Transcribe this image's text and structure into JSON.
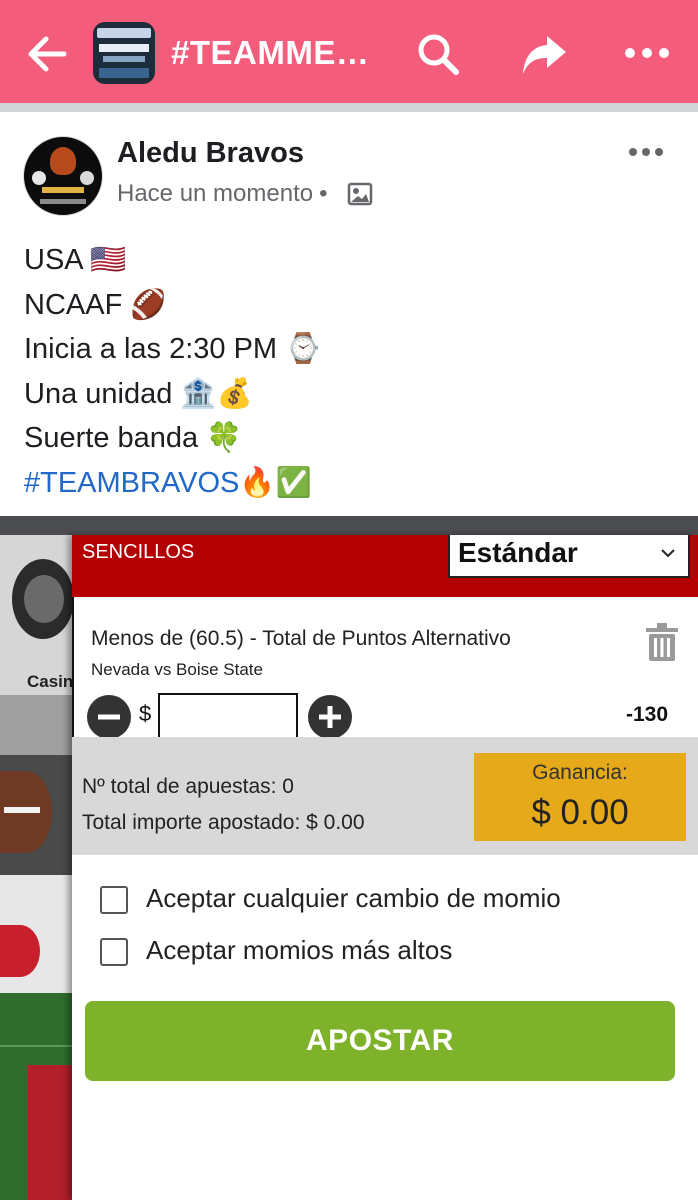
{
  "header": {
    "title": "#TEAMMEXI...",
    "group_thumb_caption": "NUEVOS BONOS SUPERBONO",
    "accent": "#f45c7c"
  },
  "post": {
    "author": "Aledu Bravos",
    "time": "Hace un momento",
    "separator": "•",
    "lines": [
      "USA 🇺🇸",
      "NCAAF 🏈",
      "Inicia a las 2:30 PM ⌚",
      "Una unidad 🏦💰",
      "Suerte banda 🍀"
    ],
    "hashtag": "#TEAMBRAVOS",
    "hashtag_emojis": "🔥✅",
    "hashtag_color": "#2168c8"
  },
  "betslip": {
    "section": "SENCILLOS",
    "mode_select": "Estándar",
    "side_tile_label": "Casin",
    "bet": {
      "market": "Menos de (60.5) - Total de Puntos Alternativo",
      "match": "Nevada vs Boise State",
      "currency": "$",
      "stake": "",
      "odds": "-130"
    },
    "summary": {
      "total_bets": "Nº total de apuestas: 0",
      "total_staked": "Total importe apostado: $ 0.00"
    },
    "gain": {
      "label": "Ganancia:",
      "value": "$ 0.00"
    },
    "options": [
      {
        "label": "Aceptar cualquier cambio de momio",
        "checked": false
      },
      {
        "label": "Aceptar momios más altos",
        "checked": false
      }
    ],
    "submit": "APOSTAR",
    "colors": {
      "header_red": "#b30003",
      "gain_gold": "#e5a91a",
      "submit_green": "#7eb22a"
    }
  }
}
